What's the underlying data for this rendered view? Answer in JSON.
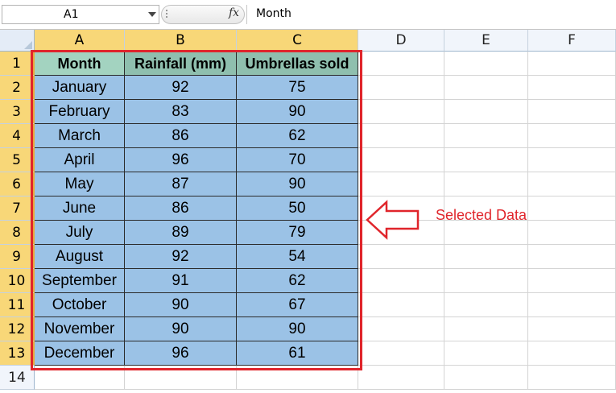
{
  "formula_bar": {
    "name_box": "A1",
    "fx_label": "fx",
    "formula": "Month"
  },
  "columns": [
    "A",
    "B",
    "C",
    "D",
    "E",
    "F"
  ],
  "rows": [
    "1",
    "2",
    "3",
    "4",
    "5",
    "6",
    "7",
    "8",
    "9",
    "10",
    "11",
    "12",
    "13",
    "14"
  ],
  "table": {
    "headers": [
      "Month",
      "Rainfall (mm)",
      "Umbrellas sold"
    ],
    "rows": [
      [
        "January",
        "92",
        "75"
      ],
      [
        "February",
        "83",
        "90"
      ],
      [
        "March",
        "86",
        "62"
      ],
      [
        "April",
        "96",
        "70"
      ],
      [
        "May",
        "87",
        "90"
      ],
      [
        "June",
        "86",
        "50"
      ],
      [
        "July",
        "89",
        "79"
      ],
      [
        "August",
        "92",
        "54"
      ],
      [
        "September",
        "91",
        "62"
      ],
      [
        "October",
        "90",
        "67"
      ],
      [
        "November",
        "90",
        "90"
      ],
      [
        "December",
        "96",
        "61"
      ]
    ]
  },
  "annotation": {
    "label": "Selected Data",
    "color": "#e0252b"
  }
}
